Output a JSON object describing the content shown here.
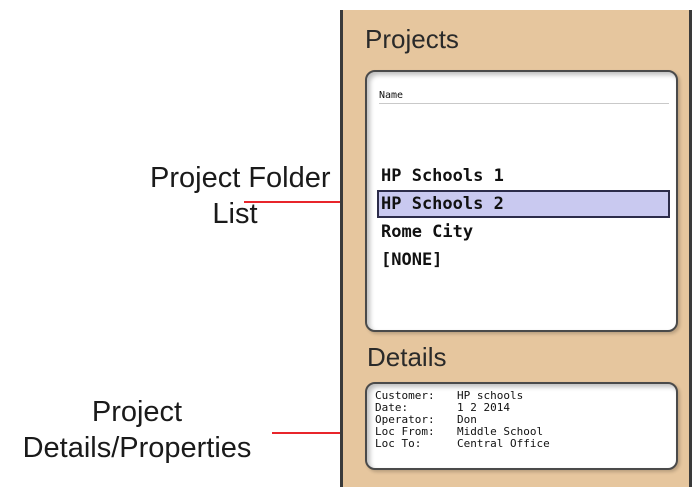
{
  "callouts": {
    "folder_list": [
      "Project  Folder",
      "List"
    ],
    "details": [
      "Project",
      "Details/Properties"
    ]
  },
  "projects": {
    "title": "Projects",
    "column_header": "Name",
    "items": [
      {
        "label": "HP Schools 1",
        "selected": false
      },
      {
        "label": "HP Schools 2",
        "selected": true
      },
      {
        "label": "Rome City",
        "selected": false
      },
      {
        "label": "[NONE]",
        "selected": false
      }
    ]
  },
  "details": {
    "title": "Details",
    "rows": [
      {
        "label": "Customer:",
        "value": "HP schools"
      },
      {
        "label": "Date:",
        "value": "1 2 2014"
      },
      {
        "label": "Operator:",
        "value": "Don"
      },
      {
        "label": "Loc From:",
        "value": "Middle School"
      },
      {
        "label": "Loc To:",
        "value": "Central Office"
      }
    ]
  },
  "colors": {
    "panel_bg": "#e6c69e",
    "selection_bg": "#c9c9f0",
    "arrow": "#e8252b"
  }
}
